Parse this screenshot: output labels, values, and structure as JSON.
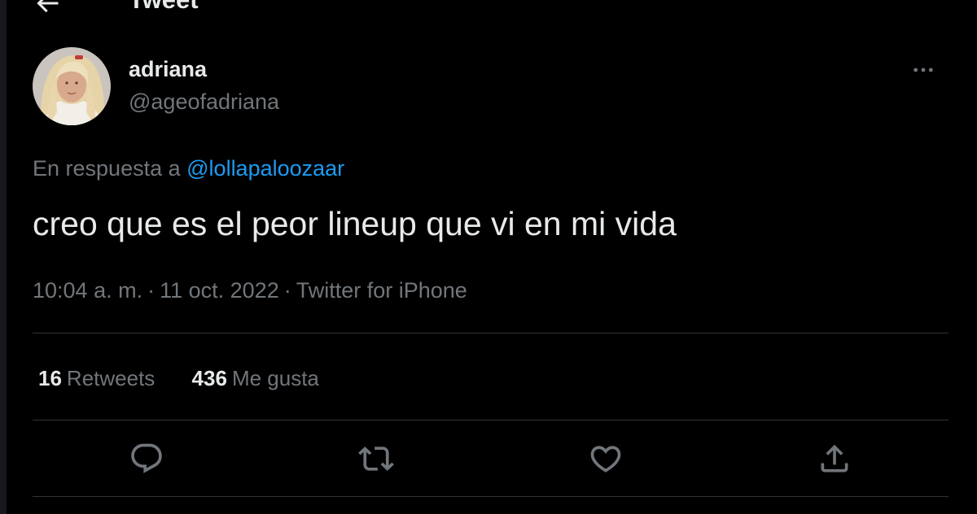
{
  "header": {
    "title": "Tweet",
    "back_icon": "arrow-left-icon"
  },
  "tweet": {
    "author": {
      "display_name": "adriana",
      "handle": "@ageofadriana",
      "avatar": "avatar-photo"
    },
    "reply_prefix": "En respuesta a",
    "reply_to": "@lollapaloozaar",
    "text": "creo que es el peor lineup que vi en mi vida",
    "time": "10:04 a. m.",
    "date": "11 oct. 2022",
    "source": "Twitter for iPhone",
    "separator": "·"
  },
  "stats": {
    "retweets_count": "16",
    "retweets_label": "Retweets",
    "likes_count": "436",
    "likes_label": "Me gusta"
  },
  "actions": {
    "reply_icon": "reply-icon",
    "retweet_icon": "retweet-icon",
    "like_icon": "heart-icon",
    "share_icon": "share-icon",
    "more_icon": "more-horizontal-icon"
  },
  "colors": {
    "background": "#000000",
    "text_primary": "#e7e9ea",
    "text_secondary": "#71767b",
    "link": "#1d9bf0",
    "divider": "#2f3336"
  }
}
